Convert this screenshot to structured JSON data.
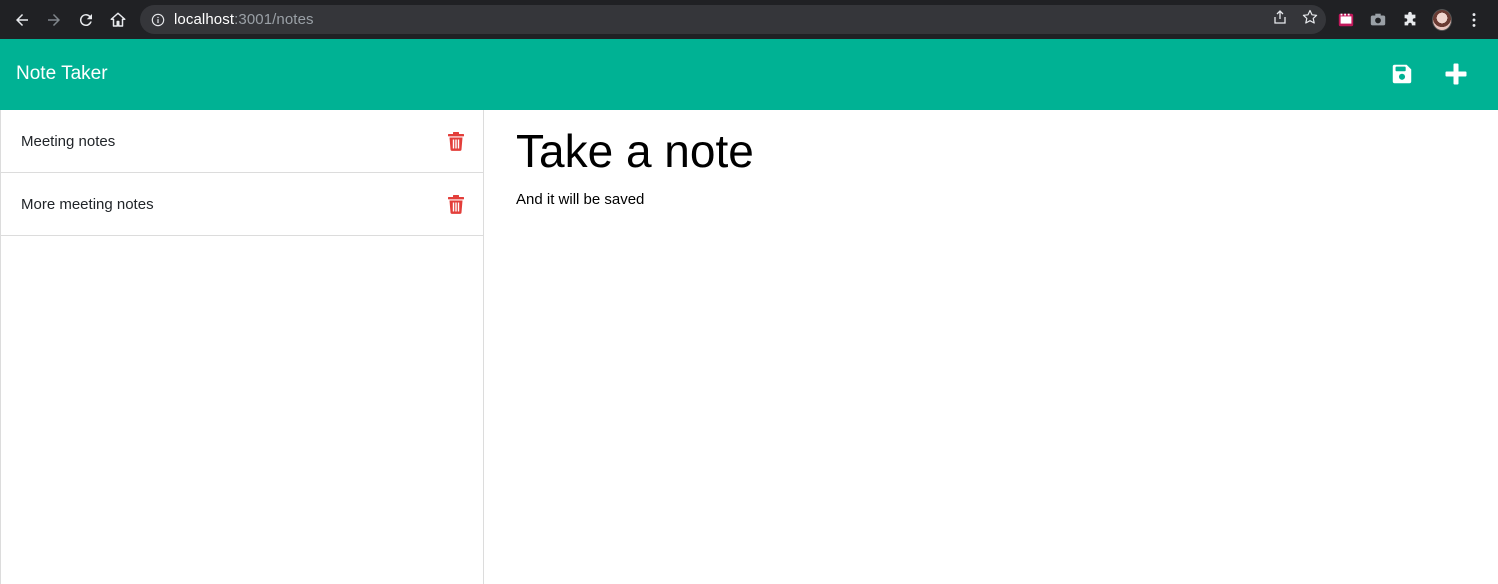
{
  "browser": {
    "url_host": "localhost",
    "url_path": ":3001/notes"
  },
  "app": {
    "brand": "Note Taker"
  },
  "notes": [
    {
      "title": "Meeting notes"
    },
    {
      "title": "More meeting notes"
    }
  ],
  "editor": {
    "title": "Take a note",
    "text": "And it will be saved"
  },
  "colors": {
    "navbar": "#00b294",
    "delete": "#e33e3a"
  },
  "icons": {
    "save": "floppy-disk-icon",
    "new": "plus-icon",
    "delete": "trash-icon"
  }
}
